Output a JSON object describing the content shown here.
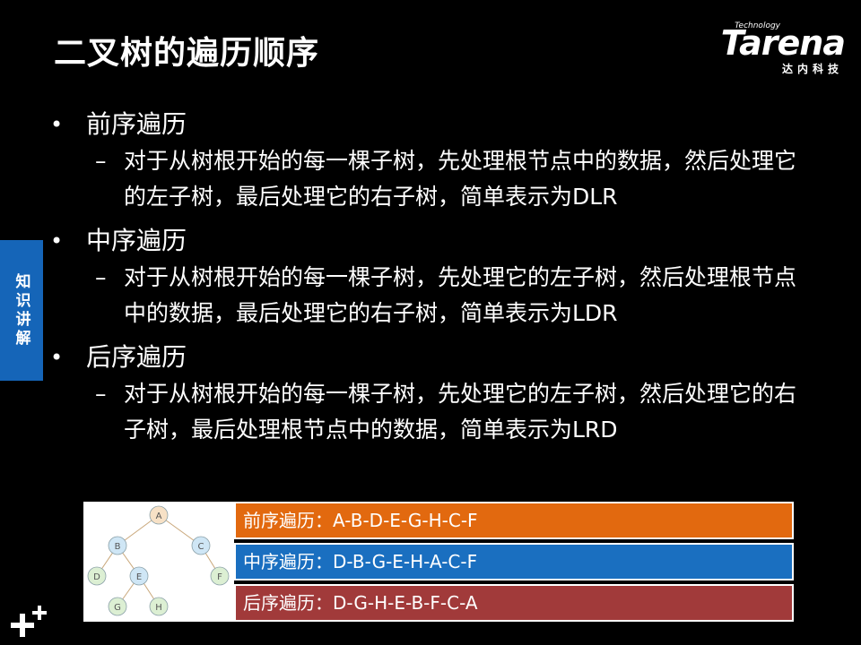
{
  "slide": {
    "title": "二叉树的遍历顺序",
    "logo": {
      "brand": "Tarena",
      "tag": "Technology",
      "cn": "达内科技"
    },
    "side_tab": "知识讲解",
    "items": [
      {
        "heading": "前序遍历",
        "text": "对于从树根开始的每一棵子树，先处理根节点中的数据，然后处理它的左子树，最后处理它的右子树，简单表示为DLR"
      },
      {
        "heading": "中序遍历",
        "text": "对于从树根开始的每一棵子树，先处理它的左子树，然后处理根节点中的数据，最后处理它的右子树，简单表示为LDR"
      },
      {
        "heading": "后序遍历",
        "text": "对于从树根开始的每一棵子树，先处理它的左子树，然后处理它的右子树，最后处理根节点中的数据，简单表示为LRD"
      }
    ],
    "results": [
      {
        "text": "前序遍历：A-B-D-E-G-H-C-F",
        "color": "#e2690f"
      },
      {
        "text": "中序遍历：D-B-G-E-H-A-C-F",
        "color": "#1a6fc0"
      },
      {
        "text": "后序遍历：D-G-H-E-B-F-C-A",
        "color": "#a13a3a"
      }
    ],
    "tree": {
      "nodes": [
        "A",
        "B",
        "C",
        "D",
        "E",
        "F",
        "G",
        "H"
      ],
      "node_colors": {
        "A": "#f7e1c6",
        "B": "#cfe6f5",
        "C": "#cfe6f5",
        "D": "#dcefd3",
        "E": "#cfe6f5",
        "F": "#dcefd3",
        "G": "#dcefd3",
        "H": "#dcefd3"
      },
      "edges": [
        [
          "A",
          "B"
        ],
        [
          "A",
          "C"
        ],
        [
          "B",
          "D"
        ],
        [
          "B",
          "E"
        ],
        [
          "C",
          "F"
        ],
        [
          "E",
          "G"
        ],
        [
          "E",
          "H"
        ]
      ]
    }
  }
}
